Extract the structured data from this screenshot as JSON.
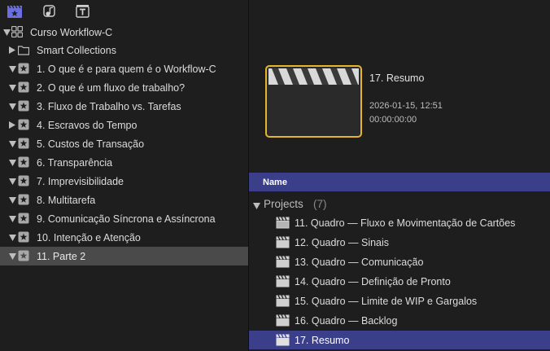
{
  "toolbar": {
    "buttons": [
      {
        "icon": "libraries-icon",
        "active": true
      },
      {
        "icon": "photos-audio-icon",
        "active": false
      },
      {
        "icon": "titles-generators-icon",
        "active": false
      }
    ]
  },
  "sidebar": {
    "library": {
      "label": "Curso Workflow-C",
      "expanded": true
    },
    "items": [
      {
        "label": "Smart Collections",
        "kind": "folder",
        "expanded": false
      },
      {
        "label": "1. O que é e para quem é o Workflow-C",
        "kind": "event",
        "expanded": true
      },
      {
        "label": "2. O que é um fluxo de trabalho?",
        "kind": "event",
        "expanded": true
      },
      {
        "label": "3. Fluxo de Trabalho vs. Tarefas",
        "kind": "event",
        "expanded": true
      },
      {
        "label": "4. Escravos do Tempo",
        "kind": "event",
        "expanded": false
      },
      {
        "label": "5. Custos de Transação",
        "kind": "event",
        "expanded": true
      },
      {
        "label": "6. Transparência",
        "kind": "event",
        "expanded": true
      },
      {
        "label": "7. Imprevisibilidade",
        "kind": "event",
        "expanded": true
      },
      {
        "label": "8. Multitarefa",
        "kind": "event",
        "expanded": true
      },
      {
        "label": "9. Comunicação Síncrona e Assíncrona",
        "kind": "event",
        "expanded": true
      },
      {
        "label": "10. Intenção e Atenção",
        "kind": "event",
        "expanded": true
      },
      {
        "label": "11. Parte 2",
        "kind": "event",
        "expanded": true,
        "selected": true
      }
    ]
  },
  "viewer": {
    "title": "17. Resumo",
    "date": "2026-01-15, 12:51",
    "timecode": "00:00:00:00"
  },
  "browser": {
    "column_name": "Name",
    "group": {
      "label": "Projects",
      "count": "(7)"
    },
    "projects": [
      {
        "label": "11. Quadro — Fluxo e Movimentação de Cartões"
      },
      {
        "label": "12. Quadro — Sinais"
      },
      {
        "label": "13. Quadro — Comunicação"
      },
      {
        "label": "14. Quadro — Definição de Pronto"
      },
      {
        "label": "15. Quadro — Limite de WIP e Gargalos"
      },
      {
        "label": "16. Quadro — Backlog"
      },
      {
        "label": "17. Resumo",
        "selected": true
      }
    ]
  },
  "colors": {
    "selection_blue": "#3b3f8a",
    "highlight_gold": "#e7b52a",
    "sidebar_selected": "#4a4a4a",
    "background": "#1e1e1e"
  }
}
